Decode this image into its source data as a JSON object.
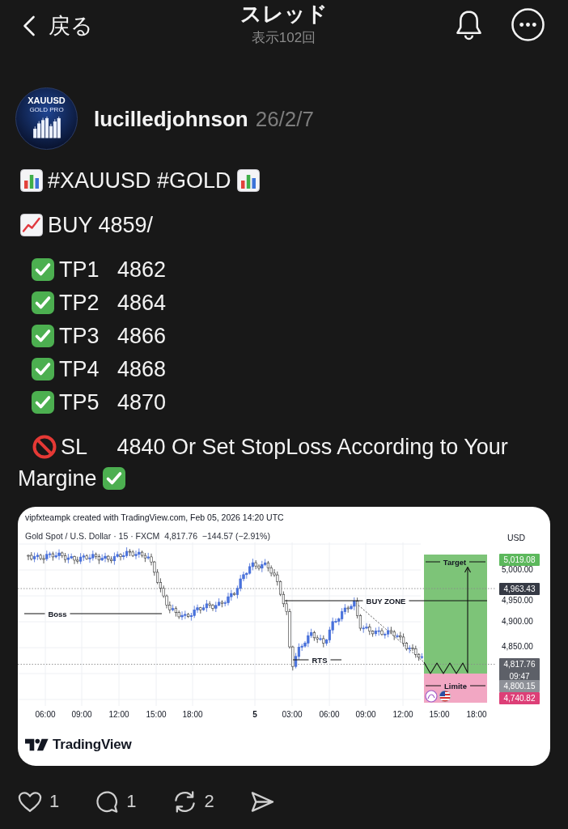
{
  "header": {
    "back_label": "戻る",
    "title": "スレッド",
    "subtitle": "表示102回"
  },
  "post": {
    "avatar": {
      "title": "XAUUSD",
      "subtitle": "GOLD PRO"
    },
    "author": "lucilledjohnson",
    "date": "26/2/7",
    "lines": [
      {
        "kind": "headline",
        "text": "#XAUUSD #GOLD"
      },
      {
        "kind": "entry",
        "text": "BUY 4859/"
      },
      {
        "kind": "target",
        "text": "TP1   4862"
      },
      {
        "kind": "target",
        "text": "TP2   4864"
      },
      {
        "kind": "target",
        "text": "TP3   4866"
      },
      {
        "kind": "target",
        "text": "TP4   4868"
      },
      {
        "kind": "target",
        "text": "TP5   4870"
      },
      {
        "kind": "stop",
        "text": "SL     4840 Or Set StopLoss According to Your"
      },
      {
        "kind": "stop_end",
        "text": "Margine"
      }
    ],
    "chart": {
      "attribution": "vipfxteampk created with TradingView.com, Feb 05, 2026 14:20 UTC",
      "legend": "Gold Spot / U.S. Dollar · 15 · FXCM  4,817.76  −144.57 (−2.91%)",
      "currency": "USD",
      "y_labels": [
        "5,000.00",
        "4,950.00",
        "4,900.00",
        "4,850.00"
      ],
      "price_tags": [
        {
          "text": "5,019.08",
          "color": "#5cb85c"
        },
        {
          "text": "4,963.43",
          "color": "#363a45"
        },
        {
          "text": "4,817.76",
          "time": "09:47",
          "color": "#5d6068"
        },
        {
          "text": "4,800.15",
          "color": "#8e9198"
        },
        {
          "text": "4,740.82",
          "color": "#dd3f77"
        }
      ],
      "x_labels": [
        {
          "text": "06:00",
          "kind": "time"
        },
        {
          "text": "09:00",
          "kind": "time"
        },
        {
          "text": "12:00",
          "kind": "time"
        },
        {
          "text": "15:00",
          "kind": "time"
        },
        {
          "text": "18:00",
          "kind": "time"
        },
        {
          "text": "5",
          "kind": "day"
        },
        {
          "text": "03:00",
          "kind": "time"
        },
        {
          "text": "06:00",
          "kind": "time"
        },
        {
          "text": "09:00",
          "kind": "time"
        },
        {
          "text": "12:00",
          "kind": "time"
        },
        {
          "text": "15:00",
          "kind": "time"
        },
        {
          "text": "18:00",
          "kind": "time"
        }
      ],
      "annotations": [
        "Boss",
        "BUY ZONE",
        "RTS",
        "Target",
        "Limite"
      ],
      "brand": "TradingView"
    },
    "actions": [
      {
        "kind": "like",
        "count": "1"
      },
      {
        "kind": "reply",
        "count": "1"
      },
      {
        "kind": "repost",
        "count": "2"
      },
      {
        "kind": "share"
      }
    ]
  }
}
